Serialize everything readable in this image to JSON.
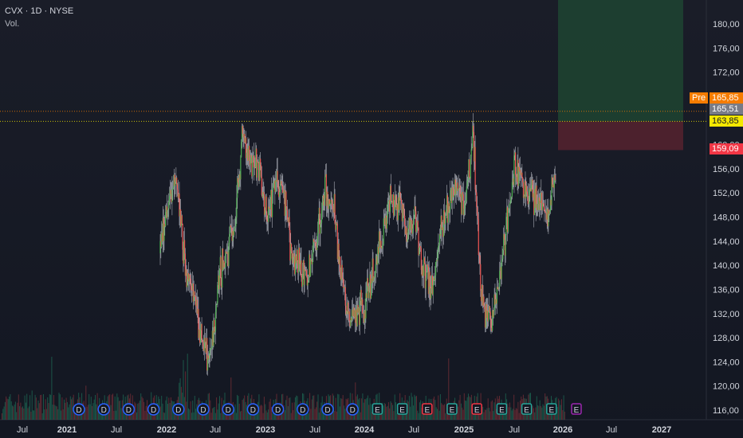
{
  "header": {
    "symbol_line": "CVX · 1D · NYSE",
    "volume_label": "Vol."
  },
  "price_tags": {
    "pre_label": "Pre",
    "pre_value": "165,85",
    "last_value": "165,51",
    "line_value": "163,85",
    "stop_value": "159,09"
  },
  "colors": {
    "background": "#131722",
    "up": "#4caf50",
    "down": "#ef5350",
    "wick": "#d1d4dc",
    "profit_zone": "#1f4a33",
    "loss_zone": "#5a2330",
    "axis_text": "#d1d4dc",
    "pre_tag": "#f57c00",
    "last_tag": "#787b86",
    "line_tag": "#f5e800",
    "stop_tag": "#f23645",
    "event_dividend": "#2962ff",
    "event_earnings_green": "#26a69a",
    "event_earnings_red": "#f23645",
    "event_earnings_upcoming": "#9c27b0"
  },
  "chart_data": {
    "type": "candlestick",
    "y_axis": {
      "ticks": [
        "116,00",
        "120,00",
        "124,00",
        "128,00",
        "132,00",
        "136,00",
        "140,00",
        "144,00",
        "148,00",
        "152,00",
        "156,00",
        "160,00",
        "164,00",
        "168,00",
        "172,00",
        "176,00",
        "180,00"
      ],
      "range": [
        114.5,
        182
      ]
    },
    "x_axis": {
      "ticks": [
        "Jul",
        "2021",
        "Jul",
        "2022",
        "Jul",
        "2023",
        "Jul",
        "2024",
        "Jul",
        "2025",
        "Jul",
        "2026",
        "Jul",
        "2027"
      ]
    },
    "price_path": [
      [
        "2022-01",
        142
      ],
      [
        "2022-02",
        151
      ],
      [
        "2022-03",
        154
      ],
      [
        "2022-04",
        140
      ],
      [
        "2022-05",
        135
      ],
      [
        "2022-06",
        128
      ],
      [
        "2022-07",
        124
      ],
      [
        "2022-08",
        137
      ],
      [
        "2022-09",
        142
      ],
      [
        "2022-10",
        146
      ],
      [
        "2022-11",
        162
      ],
      [
        "2022-12",
        158
      ],
      [
        "2023-01",
        156
      ],
      [
        "2023-02",
        147
      ],
      [
        "2023-03",
        154
      ],
      [
        "2023-04",
        151
      ],
      [
        "2023-05",
        142
      ],
      [
        "2023-06",
        140
      ],
      [
        "2023-07",
        138
      ],
      [
        "2023-08",
        145
      ],
      [
        "2023-09",
        152
      ],
      [
        "2023-10",
        150
      ],
      [
        "2023-11",
        138
      ],
      [
        "2023-12",
        131
      ],
      [
        "2024-01",
        132
      ],
      [
        "2024-02",
        134
      ],
      [
        "2024-03",
        140
      ],
      [
        "2024-04",
        145
      ],
      [
        "2024-05",
        152
      ],
      [
        "2024-06",
        150
      ],
      [
        "2024-07",
        146
      ],
      [
        "2024-08",
        148
      ],
      [
        "2024-09",
        139
      ],
      [
        "2024-10",
        136
      ],
      [
        "2024-11",
        145
      ],
      [
        "2024-12",
        150
      ],
      [
        "2025-01",
        153
      ],
      [
        "2025-02",
        150
      ],
      [
        "2025-03",
        162
      ],
      [
        "2025-04",
        134
      ],
      [
        "2025-05",
        130
      ],
      [
        "2025-06",
        136
      ],
      [
        "2025-07",
        146
      ],
      [
        "2025-08",
        156
      ],
      [
        "2025-09",
        154
      ],
      [
        "2025-10",
        152
      ],
      [
        "2025-11",
        150
      ],
      [
        "2025-12",
        148
      ],
      [
        "2026-01",
        155
      ]
    ],
    "horizontal_lines": [
      165.51,
      163.85
    ],
    "position": {
      "entry": 163.85,
      "target": 182,
      "stop": 159.09,
      "start": "2026-01",
      "end": "2027-04"
    },
    "events": [
      "D",
      "D",
      "D",
      "D",
      "D",
      "D",
      "D",
      "D",
      "D",
      "D",
      "D",
      "D",
      "E",
      "E",
      "E",
      "E",
      "E",
      "E",
      "E",
      "E",
      "E"
    ]
  }
}
